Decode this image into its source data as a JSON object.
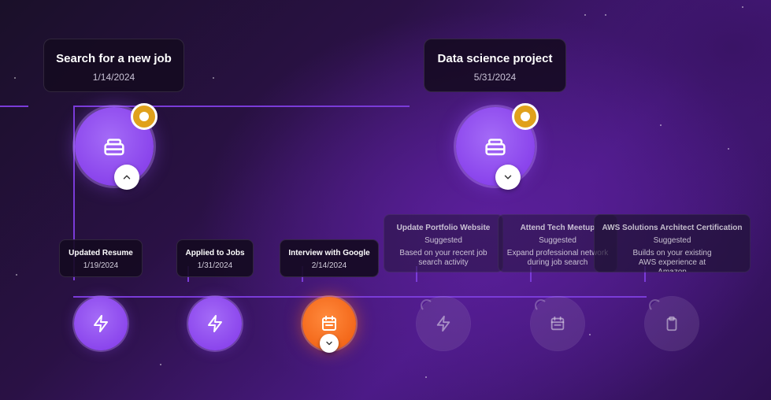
{
  "milestones": [
    {
      "title": "Search for a new job",
      "date": "1/14/2024",
      "icon": "briefcase-icon",
      "toggle": "chevron-up-icon"
    },
    {
      "title": "Data science project",
      "date": "5/31/2024",
      "icon": "briefcase-icon",
      "toggle": "chevron-down-icon"
    }
  ],
  "steps": [
    {
      "title": "Updated Resume",
      "date": "1/19/2024",
      "icon": "bolt-icon"
    },
    {
      "title": "Applied to Jobs",
      "date": "1/31/2024",
      "icon": "bolt-icon"
    },
    {
      "title": "Interview with Google",
      "date": "2/14/2024",
      "icon": "calendar-icon",
      "toggle": "chevron-down-icon"
    }
  ],
  "suggestions": [
    {
      "title": "Update Portfolio Website",
      "status": "Suggested",
      "description": "Based on your recent job search activity",
      "icon": "bolt-icon"
    },
    {
      "title": "Attend Tech Meetup",
      "status": "Suggested",
      "description": "Expand professional network during job search",
      "icon": "calendar-icon"
    },
    {
      "title": "AWS Solutions Architect Certification",
      "status": "Suggested",
      "description": "Builds on your existing AWS experience at Amazon",
      "icon": "clipboard-icon"
    }
  ],
  "colors": {
    "accent_purple": "#8a44ec",
    "active_orange": "#f26315",
    "badge_gold": "#e0a11c",
    "line": "#7a3bd8"
  }
}
